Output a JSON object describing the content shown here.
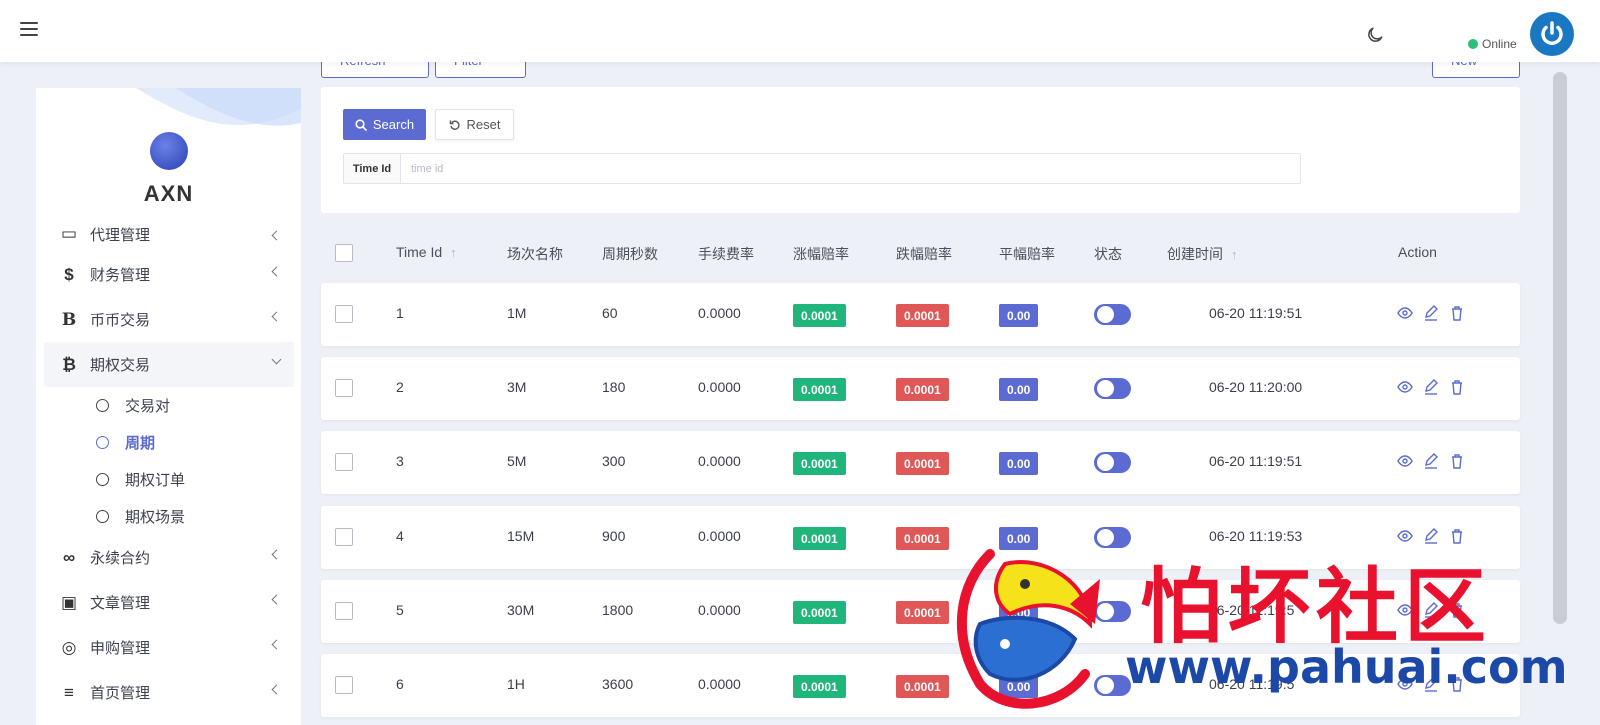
{
  "header": {
    "online_label": "Online"
  },
  "toolbar": {
    "refresh_label": "Refresh",
    "filter_label": "Filter",
    "new_label": "New"
  },
  "sidebar": {
    "brand": "AXN",
    "items": [
      {
        "label": "代理管理",
        "icon": "agent-icon"
      },
      {
        "label": "财务管理",
        "icon": "dollar-icon"
      },
      {
        "label": "币币交易",
        "icon": "bitcoin-b-icon"
      },
      {
        "label": "期权交易",
        "icon": "bitcoin-icon",
        "expanded": true
      },
      {
        "label": "永续合约",
        "icon": "link-icon"
      },
      {
        "label": "文章管理",
        "icon": "article-icon"
      },
      {
        "label": "申购管理",
        "icon": "lifebuoy-icon"
      },
      {
        "label": "首页管理",
        "icon": "list-icon"
      }
    ],
    "sub_items": [
      {
        "label": "交易对"
      },
      {
        "label": "周期",
        "current": true
      },
      {
        "label": "期权订单"
      },
      {
        "label": "期权场景"
      }
    ]
  },
  "search": {
    "search_label": "Search",
    "reset_label": "Reset",
    "field_label": "Time Id",
    "field_placeholder": "time id"
  },
  "table": {
    "columns": [
      "Time Id",
      "场次名称",
      "周期秒数",
      "手续费率",
      "涨幅赔率",
      "跌幅赔率",
      "平幅赔率",
      "状态",
      "创建时间",
      "Action"
    ],
    "rows": [
      {
        "id": "1",
        "name": "1M",
        "seconds": "60",
        "fee": "0.0000",
        "up": "0.0001",
        "down": "0.0001",
        "flat": "0.00",
        "created": "06-20 11:19:51"
      },
      {
        "id": "2",
        "name": "3M",
        "seconds": "180",
        "fee": "0.0000",
        "up": "0.0001",
        "down": "0.0001",
        "flat": "0.00",
        "created": "06-20 11:20:00"
      },
      {
        "id": "3",
        "name": "5M",
        "seconds": "300",
        "fee": "0.0000",
        "up": "0.0001",
        "down": "0.0001",
        "flat": "0.00",
        "created": "06-20 11:19:51"
      },
      {
        "id": "4",
        "name": "15M",
        "seconds": "900",
        "fee": "0.0000",
        "up": "0.0001",
        "down": "0.0001",
        "flat": "0.00",
        "created": "06-20 11:19:53"
      },
      {
        "id": "5",
        "name": "30M",
        "seconds": "1800",
        "fee": "0.0000",
        "up": "0.0001",
        "down": "0.0001",
        "flat": "0.00",
        "created": "06-20 11:19:5"
      },
      {
        "id": "6",
        "name": "1H",
        "seconds": "3600",
        "fee": "0.0000",
        "up": "0.0001",
        "down": "0.0001",
        "flat": "0.00",
        "created": "06-20 11:19:5"
      }
    ]
  },
  "watermark": {
    "title": "怕坏社区",
    "url": "www.pahuai.com"
  },
  "colors": {
    "primary": "#5b6bd1",
    "success": "#1fb57b",
    "danger": "#e05757",
    "online": "#2bbf7a",
    "watermark_red": "#e8122e",
    "watermark_blue": "#1c49a7"
  }
}
